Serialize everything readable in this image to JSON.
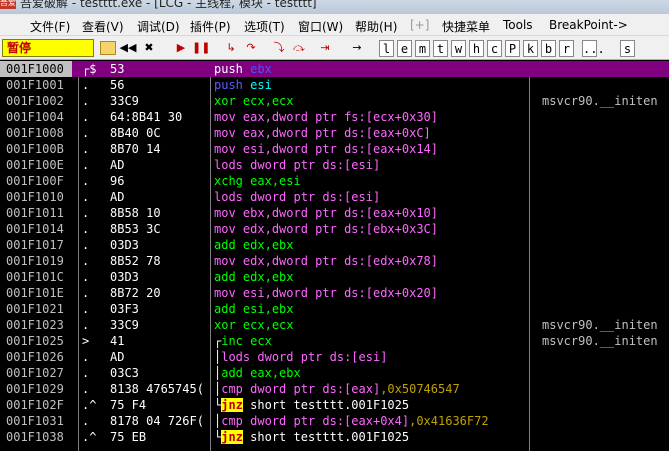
{
  "window": {
    "title": "吾爱破解 - testttt.exe - [LCG - 主线程, 模块 - testttt]",
    "icon": "吾爱"
  },
  "menu": [
    "文件(F)",
    "查看(V)",
    "调试(D)",
    "插件(P)",
    "选项(T)",
    "窗口(W)",
    "帮助(H)",
    "[+]",
    "快捷菜单",
    "Tools",
    "BreakPoint->"
  ],
  "toolbar": {
    "status": "暂停",
    "buttons": [
      "open-icon",
      "rewind-icon",
      "close-icon",
      "run-icon",
      "pause-icon",
      "step-into-icon",
      "step-over-icon",
      "trace-into-icon",
      "trace-over-icon",
      "execute-till-return-icon",
      "goto-icon"
    ],
    "letters": [
      "l",
      "e",
      "m",
      "t",
      "w",
      "h",
      "c",
      "P",
      "k",
      "b",
      "r",
      "...",
      "s"
    ]
  },
  "disasm": [
    {
      "addr": "001F1000",
      "mark": "┌$",
      "hex": "53",
      "kw": "push",
      "ops": "ebx",
      "cmt": "",
      "kind": "push",
      "selected": true
    },
    {
      "addr": "001F1001",
      "mark": ".",
      "hex": "56",
      "kw": "push",
      "ops": "esi",
      "cmt": "",
      "kind": "push"
    },
    {
      "addr": "001F1002",
      "mark": ".",
      "hex": "33C9",
      "kw": "xor",
      "ops": "ecx,ecx",
      "cmt": "msvcr90.__initen",
      "kind": "xor"
    },
    {
      "addr": "001F1004",
      "mark": ".",
      "hex": "64:8B41 30",
      "kw": "mov",
      "ops": "eax,dword ptr fs:[ecx+0x30]",
      "cmt": "",
      "kind": "mov"
    },
    {
      "addr": "001F1008",
      "mark": ".",
      "hex": "8B40 0C",
      "kw": "mov",
      "ops": "eax,dword ptr ds:[eax+0xC]",
      "cmt": "",
      "kind": "mov"
    },
    {
      "addr": "001F100B",
      "mark": ".",
      "hex": "8B70 14",
      "kw": "mov",
      "ops": "esi,dword ptr ds:[eax+0x14]",
      "cmt": "",
      "kind": "mov"
    },
    {
      "addr": "001F100E",
      "mark": ".",
      "hex": "AD",
      "kw": "lods",
      "ops": "dword ptr ds:[esi]",
      "cmt": "",
      "kind": "lods"
    },
    {
      "addr": "001F100F",
      "mark": ".",
      "hex": "96",
      "kw": "xchg",
      "ops": "eax,esi",
      "cmt": "",
      "kind": "xchg"
    },
    {
      "addr": "001F1010",
      "mark": ".",
      "hex": "AD",
      "kw": "lods",
      "ops": "dword ptr ds:[esi]",
      "cmt": "",
      "kind": "lods"
    },
    {
      "addr": "001F1011",
      "mark": ".",
      "hex": "8B58 10",
      "kw": "mov",
      "ops": "ebx,dword ptr ds:[eax+0x10]",
      "cmt": "",
      "kind": "mov"
    },
    {
      "addr": "001F1014",
      "mark": ".",
      "hex": "8B53 3C",
      "kw": "mov",
      "ops": "edx,dword ptr ds:[ebx+0x3C]",
      "cmt": "",
      "kind": "mov"
    },
    {
      "addr": "001F1017",
      "mark": ".",
      "hex": "03D3",
      "kw": "add",
      "ops": "edx,ebx",
      "cmt": "",
      "kind": "add"
    },
    {
      "addr": "001F1019",
      "mark": ".",
      "hex": "8B52 78",
      "kw": "mov",
      "ops": "edx,dword ptr ds:[edx+0x78]",
      "cmt": "",
      "kind": "mov"
    },
    {
      "addr": "001F101C",
      "mark": ".",
      "hex": "03D3",
      "kw": "add",
      "ops": "edx,ebx",
      "cmt": "",
      "kind": "add"
    },
    {
      "addr": "001F101E",
      "mark": ".",
      "hex": "8B72 20",
      "kw": "mov",
      "ops": "esi,dword ptr ds:[edx+0x20]",
      "cmt": "",
      "kind": "mov"
    },
    {
      "addr": "001F1021",
      "mark": ".",
      "hex": "03F3",
      "kw": "add",
      "ops": "esi,ebx",
      "cmt": "",
      "kind": "add"
    },
    {
      "addr": "001F1023",
      "mark": ".",
      "hex": "33C9",
      "kw": "xor",
      "ops": "ecx,ecx",
      "cmt": "msvcr90.__initen",
      "kind": "xor"
    },
    {
      "addr": "001F1025",
      "mark": ">",
      "hex": "41",
      "kw": "inc",
      "ops": "ecx",
      "cmt": "msvcr90.__initen",
      "kind": "inc",
      "bracket": "┌"
    },
    {
      "addr": "001F1026",
      "mark": ".",
      "hex": "AD",
      "kw": "lods",
      "ops": "dword ptr ds:[esi]",
      "cmt": "",
      "kind": "lods",
      "bracket": "│"
    },
    {
      "addr": "001F1027",
      "mark": ".",
      "hex": "03C3",
      "kw": "add",
      "ops": "eax,ebx",
      "cmt": "",
      "kind": "add",
      "bracket": "│"
    },
    {
      "addr": "001F1029",
      "mark": ".",
      "hex": "8138 4765745(",
      "kw": "cmp",
      "ops": "dword ptr ds:[eax]",
      "imm": ",0x50746547",
      "cmt": "",
      "kind": "cmp",
      "bracket": "│"
    },
    {
      "addr": "001F102F",
      "mark": ".^",
      "hex": "75 F4",
      "kw": "jnz",
      "ops": "short testttt.001F1025",
      "cmt": "",
      "kind": "jnz",
      "bracket": "└"
    },
    {
      "addr": "001F1031",
      "mark": ".",
      "hex": "8178 04 726F(",
      "kw": "cmp",
      "ops": "dword ptr ds:[eax+0x4]",
      "imm": ",0x41636F72",
      "cmt": "",
      "kind": "cmp",
      "bracket": "│"
    },
    {
      "addr": "001F1038",
      "mark": ".^",
      "hex": "75 EB",
      "kw": "jnz",
      "ops": "short testttt.001F1025",
      "cmt": "",
      "kind": "jnz",
      "bracket": "└"
    }
  ],
  "colors": {
    "background": "#000000",
    "selection": "#800080",
    "address": "#c0c0c0",
    "mnemonic_mov": "#ff66ff",
    "mnemonic_arith": "#00ff00",
    "jump_highlight": "#ffff00",
    "status_bg": "#ffff00"
  }
}
